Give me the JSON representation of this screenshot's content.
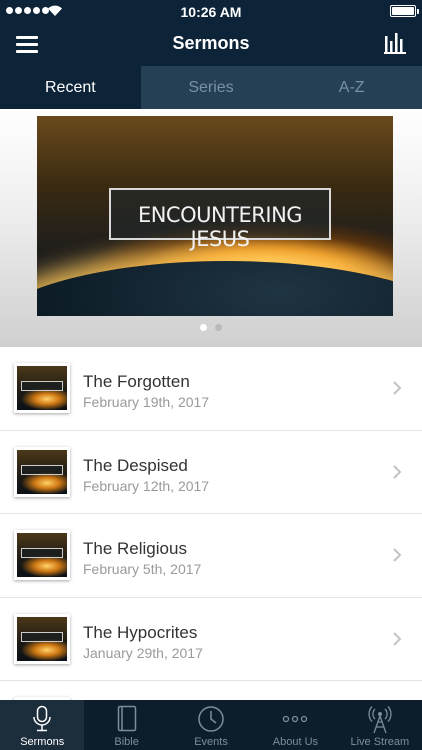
{
  "status": {
    "time": "10:26 AM"
  },
  "header": {
    "title": "Sermons"
  },
  "tabs": [
    {
      "label": "Recent",
      "active": true
    },
    {
      "label": "Series",
      "active": false
    },
    {
      "label": "A-Z",
      "active": false
    }
  ],
  "banner": {
    "title": "ENCOUNTERING JESUS",
    "page_count": 2,
    "current_page": 1
  },
  "sermons": [
    {
      "title": "The Forgotten",
      "date": "February 19th, 2017"
    },
    {
      "title": "The Despised",
      "date": "February 12th, 2017"
    },
    {
      "title": "The Religious",
      "date": "February 5th, 2017"
    },
    {
      "title": "The Hypocrites",
      "date": "January 29th, 2017"
    }
  ],
  "tabbar": [
    {
      "label": "Sermons",
      "icon": "microphone-icon",
      "active": true
    },
    {
      "label": "Bible",
      "icon": "book-icon",
      "active": false
    },
    {
      "label": "Events",
      "icon": "clock-icon",
      "active": false
    },
    {
      "label": "About Us",
      "icon": "more-dots-icon",
      "active": false
    },
    {
      "label": "Live Stream",
      "icon": "broadcast-tower-icon",
      "active": false
    }
  ],
  "colors": {
    "nav": "#0d2438",
    "tabs_bg": "#253f55",
    "tabbar": "#0d1d2b"
  }
}
